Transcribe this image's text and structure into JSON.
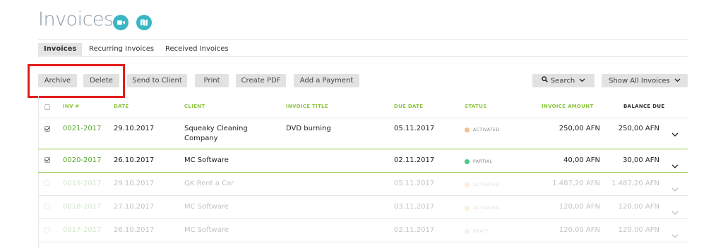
{
  "header": {
    "title": "Invoices",
    "icons": [
      "video-icon",
      "map-icon"
    ]
  },
  "tabs": [
    {
      "label": "Invoices",
      "active": true
    },
    {
      "label": "Recurring Invoices",
      "active": false
    },
    {
      "label": "Received Invoices",
      "active": false
    }
  ],
  "toolbar": {
    "archive": "Archive",
    "delete": "Delete",
    "send": "Send to Client",
    "print": "Print",
    "pdf": "Create PDF",
    "payment": "Add a Payment",
    "search": "Search",
    "filter": "Show All Invoices"
  },
  "columns": {
    "inv": "INV #",
    "date": "DATE",
    "client": "CLIENT",
    "title": "INVOICE TITLE",
    "due": "DUE DATE",
    "status": "STATUS",
    "amount": "INVOICE AMOUNT",
    "balance": "BALANCE DUE"
  },
  "rows": [
    {
      "inv": "0021-2017",
      "date": "29.10.2017",
      "client_line1": "Squeaky Cleaning",
      "client_line2": "Company",
      "title": "DVD burning",
      "due": "05.11.2017",
      "status": "ACTIVATED",
      "amount": "250,00 AFN",
      "balance": "250,00 AFN",
      "checked": true
    },
    {
      "inv": "0020-2017",
      "date": "26.10.2017",
      "client_line1": "MC Software",
      "client_line2": "",
      "title": "",
      "due": "02.11.2017",
      "status": "PARTIAL",
      "amount": "40,00 AFN",
      "balance": "30,00 AFN",
      "checked": true
    },
    {
      "inv": "0019-2017",
      "date": "29.10.2017",
      "client_line1": "QK Rent a Car",
      "client_line2": "",
      "title": "",
      "due": "05.11.2017",
      "status": "ACTIVATED",
      "amount": "1.487,20 AFN",
      "balance": "1.487,20 AFN",
      "checked": false
    },
    {
      "inv": "0018-2017",
      "date": "27.10.2017",
      "client_line1": "MC Software",
      "client_line2": "",
      "title": "",
      "due": "03.11.2017",
      "status": "ACTIVATED",
      "amount": "120,00 AFN",
      "balance": "120,00 AFN",
      "checked": false
    },
    {
      "inv": "0017-2017",
      "date": "26.10.2017",
      "client_line1": "MC Software",
      "client_line2": "",
      "title": "",
      "due": "02.11.2017",
      "status": "DRAFT",
      "amount": "120,00 AFN",
      "balance": "120,00 AFN",
      "checked": false
    }
  ],
  "colors": {
    "accent": "#8cc63f",
    "activated": "#f5c18a",
    "partial": "#4cc68a",
    "draft": "#cfcfcf",
    "icon_teal": "#3bb6c4",
    "highlight": "#e31b1b"
  }
}
